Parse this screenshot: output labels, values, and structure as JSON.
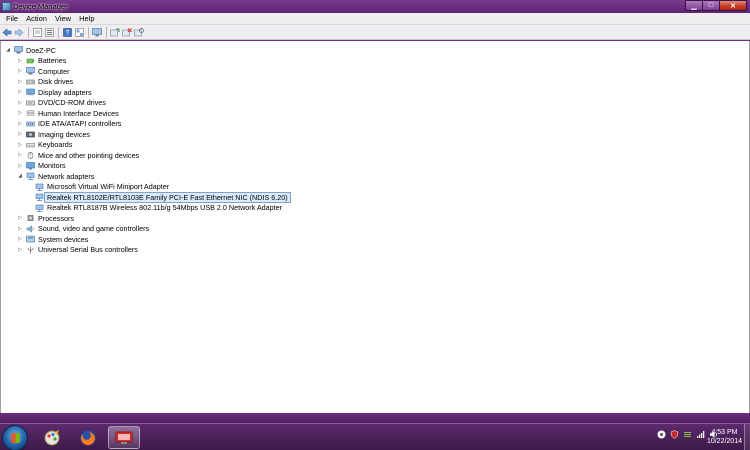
{
  "window": {
    "title": "Device Manager"
  },
  "menu": [
    "File",
    "Action",
    "View",
    "Help"
  ],
  "toolbar_icons": [
    "back-arrow-icon",
    "forward-arrow-icon",
    "properties-icon",
    "list-view-icon",
    "help-icon",
    "device-view-icon",
    "monitor-icon",
    "update-driver-icon",
    "uninstall-icon",
    "scan-hardware-icon"
  ],
  "tree": {
    "root": "DoeZ-PC",
    "categories": [
      {
        "label": "Batteries",
        "icon": "battery-icon",
        "color": "#3e8f2f"
      },
      {
        "label": "Computer",
        "icon": "computer-icon",
        "color": "#3a6ea8"
      },
      {
        "label": "Disk drives",
        "icon": "disk-drive-icon",
        "color": "#808080"
      },
      {
        "label": "Display adapters",
        "icon": "display-adapter-icon",
        "color": "#2f7fc1"
      },
      {
        "label": "DVD/CD-ROM drives",
        "icon": "dvd-drive-icon",
        "color": "#707070"
      },
      {
        "label": "Human Interface Devices",
        "icon": "hid-icon",
        "color": "#8a8a8a"
      },
      {
        "label": "IDE ATA/ATAPI controllers",
        "icon": "ide-controller-icon",
        "color": "#5a7ea8"
      },
      {
        "label": "Imaging devices",
        "icon": "camera-icon",
        "color": "#555555"
      },
      {
        "label": "Keyboards",
        "icon": "keyboard-icon",
        "color": "#7a7a7a"
      },
      {
        "label": "Mice and other pointing devices",
        "icon": "mouse-icon",
        "color": "#6f6f6f"
      },
      {
        "label": "Monitors",
        "icon": "monitor-icon",
        "color": "#2f6fb0"
      },
      {
        "label": "Network adapters",
        "icon": "network-adapter-icon",
        "color": "#3c78b4",
        "expanded": true,
        "children": [
          {
            "label": "Microsoft Virtual WiFi Miniport Adapter",
            "icon": "network-adapter-icon"
          },
          {
            "label": "Realtek RTL8102E/RTL8103E Family PCI-E Fast Ethernet NIC (NDIS 6.20)",
            "icon": "network-adapter-icon",
            "selected": true
          },
          {
            "label": "Realtek RTL8187B Wireless 802.11b/g 54Mbps USB 2.0 Network Adapter",
            "icon": "network-adapter-icon"
          }
        ]
      },
      {
        "label": "Processors",
        "icon": "processor-icon",
        "color": "#6a6a6a"
      },
      {
        "label": "Sound, video and game controllers",
        "icon": "sound-icon",
        "color": "#5b7ea3"
      },
      {
        "label": "System devices",
        "icon": "system-device-icon",
        "color": "#3f77ad"
      },
      {
        "label": "Universal Serial Bus controllers",
        "icon": "usb-icon",
        "color": "#777777"
      }
    ]
  },
  "taskbar": {
    "apps": [
      "paint-icon",
      "firefox-icon",
      "device-manager-icon"
    ],
    "tray": [
      "speaker-icon",
      "shield-icon",
      "wifi-icon",
      "signal-icon",
      "volume-icon"
    ],
    "time": "4:53 PM",
    "date": "10/22/2014"
  }
}
